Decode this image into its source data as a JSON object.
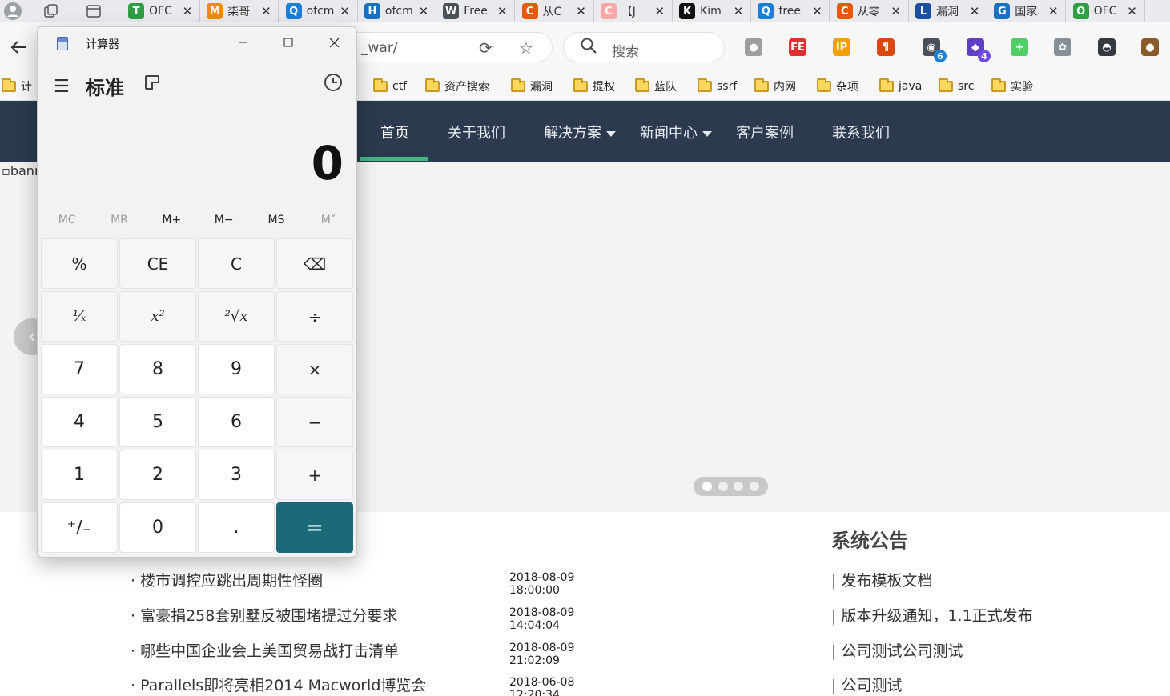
{
  "browser": {
    "tabs": [
      {
        "title": "OFC",
        "favicon": "T",
        "favicon_color": "#2f9e44"
      },
      {
        "title": "柒哥",
        "favicon": "M",
        "favicon_color": "#f08c00"
      },
      {
        "title": "ofcm",
        "favicon": "Q",
        "favicon_color": "#1c7ed6"
      },
      {
        "title": "ofcm",
        "favicon": "H",
        "favicon_color": "#1971c2"
      },
      {
        "title": "Free",
        "favicon": "W",
        "favicon_color": "#495057"
      },
      {
        "title": "从C",
        "favicon": "C",
        "favicon_color": "#e8590c"
      },
      {
        "title": "【J",
        "favicon": "C",
        "favicon_color": "#ffa8a8"
      },
      {
        "title": "Kim",
        "favicon": "K",
        "favicon_color": "#111111"
      },
      {
        "title": "free",
        "favicon": "Q",
        "favicon_color": "#1c7ed6"
      },
      {
        "title": "从零",
        "favicon": "C",
        "favicon_color": "#e8590c"
      },
      {
        "title": "漏洞",
        "favicon": "L",
        "favicon_color": "#1c4fa0"
      },
      {
        "title": "国家",
        "favicon": "G",
        "favicon_color": "#1971c2"
      },
      {
        "title": "OFC",
        "favicon": "O",
        "favicon_color": "#2f9e44"
      }
    ],
    "url": "_war/",
    "search_placeholder": "搜索",
    "extensions": [
      {
        "name": "record-extension-icon",
        "glyph": "●",
        "color": "#9e9e9e",
        "badge": ""
      },
      {
        "name": "fe-extension-icon",
        "glyph": "FE",
        "color": "#e03131",
        "badge": ""
      },
      {
        "name": "ip-extension-icon",
        "glyph": "IP",
        "color": "#f59f00",
        "badge": ""
      },
      {
        "name": "pilcrow-extension-icon",
        "glyph": "¶",
        "color": "#d9480f",
        "badge": ""
      },
      {
        "name": "panda-extension-icon",
        "glyph": "◉",
        "color": "#495057",
        "badge": "6"
      },
      {
        "name": "cube-extension-icon",
        "glyph": "◆",
        "color": "#5f3dc4",
        "badge": "4"
      },
      {
        "name": "plus-extension-icon",
        "glyph": "+",
        "color": "#51cf66",
        "badge": ""
      },
      {
        "name": "flower-extension-icon",
        "glyph": "✿",
        "color": "#868e96",
        "badge": ""
      },
      {
        "name": "hat-extension-icon",
        "glyph": "◓",
        "color": "#343a40",
        "badge": ""
      },
      {
        "name": "cookie-extension-icon",
        "glyph": "●",
        "color": "#8a5a2b",
        "badge": ""
      }
    ],
    "bookmarks": [
      "计",
      "ctf",
      "资产搜索",
      "漏洞",
      "提权",
      "蓝队",
      "ssrf",
      "内网",
      "杂项",
      "java",
      "src",
      "实验"
    ]
  },
  "site": {
    "nav": [
      "首页",
      "关于我们",
      "解决方案",
      "新闻中心",
      "客户案例",
      "联系我们"
    ],
    "banner_alt": "banr",
    "news": [
      {
        "title": "· 楼市调控应跳出周期性怪圈",
        "date": "2018-08-09 18:00:00"
      },
      {
        "title": "· 富豪捐258套别墅反被围堵提过分要求",
        "date": "2018-08-09 14:04:04"
      },
      {
        "title": "· 哪些中国企业会上美国贸易战打击清单",
        "date": "2018-08-09 21:02:09"
      },
      {
        "title": "· Parallels即将亮相2014 Macworld博览会",
        "date": "2018-06-08 12:20:34"
      }
    ],
    "notice_title": "系统公告",
    "notices": [
      "| 发布模板文档",
      "| 版本升级通知，1.1正式发布",
      "| 公司测试公司测试",
      "| 公司测试"
    ]
  },
  "calculator": {
    "window_title": "计算器",
    "mode": "标准",
    "display": "0",
    "memory": [
      {
        "label": "MC",
        "enabled": false
      },
      {
        "label": "MR",
        "enabled": false
      },
      {
        "label": "M+",
        "enabled": true
      },
      {
        "label": "M−",
        "enabled": true
      },
      {
        "label": "MS",
        "enabled": true
      },
      {
        "label": "M˅",
        "enabled": false
      }
    ],
    "keys": [
      {
        "label": "%",
        "name": "percent-key",
        "kind": "op"
      },
      {
        "label": "CE",
        "name": "clear-entry-key",
        "kind": "op"
      },
      {
        "label": "C",
        "name": "clear-key",
        "kind": "op"
      },
      {
        "label": "⌫",
        "name": "backspace-key",
        "kind": "op"
      },
      {
        "label": "¹⁄ₓ",
        "name": "reciprocal-key",
        "kind": "op",
        "math": true
      },
      {
        "label": "x²",
        "name": "square-key",
        "kind": "op",
        "math": true
      },
      {
        "label": "²√x",
        "name": "square-root-key",
        "kind": "op",
        "math": true
      },
      {
        "label": "÷",
        "name": "divide-key",
        "kind": "op"
      },
      {
        "label": "7",
        "name": "digit-7-key",
        "kind": "num"
      },
      {
        "label": "8",
        "name": "digit-8-key",
        "kind": "num"
      },
      {
        "label": "9",
        "name": "digit-9-key",
        "kind": "num"
      },
      {
        "label": "×",
        "name": "multiply-key",
        "kind": "op"
      },
      {
        "label": "4",
        "name": "digit-4-key",
        "kind": "num"
      },
      {
        "label": "5",
        "name": "digit-5-key",
        "kind": "num"
      },
      {
        "label": "6",
        "name": "digit-6-key",
        "kind": "num"
      },
      {
        "label": "−",
        "name": "subtract-key",
        "kind": "op"
      },
      {
        "label": "1",
        "name": "digit-1-key",
        "kind": "num"
      },
      {
        "label": "2",
        "name": "digit-2-key",
        "kind": "num"
      },
      {
        "label": "3",
        "name": "digit-3-key",
        "kind": "num"
      },
      {
        "label": "+",
        "name": "add-key",
        "kind": "op"
      },
      {
        "label": "⁺∕₋",
        "name": "negate-key",
        "kind": "num"
      },
      {
        "label": "0",
        "name": "digit-0-key",
        "kind": "num"
      },
      {
        "label": ".",
        "name": "decimal-key",
        "kind": "num"
      },
      {
        "label": "=",
        "name": "equals-key",
        "kind": "equals"
      }
    ],
    "accent_color": "#1b6a79"
  }
}
